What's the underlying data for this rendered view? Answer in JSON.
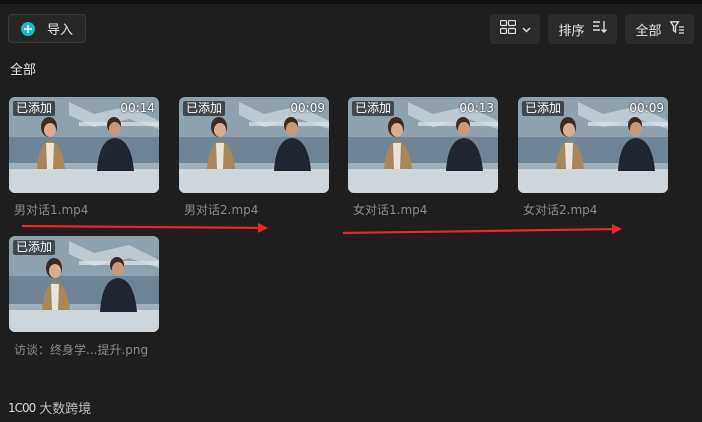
{
  "toolbar": {
    "import_label": "导入",
    "sort_label": "排序",
    "filter_label": "全部"
  },
  "section": {
    "title": "全部"
  },
  "media": [
    {
      "badge": "已添加",
      "duration": "00:14",
      "filename": "男对话1.mp4"
    },
    {
      "badge": "已添加",
      "duration": "00:09",
      "filename": "男对话2.mp4"
    },
    {
      "badge": "已添加",
      "duration": "00:13",
      "filename": "女对话1.mp4"
    },
    {
      "badge": "已添加",
      "duration": "00:09",
      "filename": "女对话2.mp4"
    },
    {
      "badge": "已添加",
      "duration": "",
      "filename": "访谈：终身学...提升.png"
    }
  ],
  "watermark": {
    "logo": "1C00",
    "text": "大数跨境"
  },
  "colors": {
    "accent": "#1fb8c9",
    "arrow": "#e8262b",
    "background": "#1e1e1e"
  }
}
